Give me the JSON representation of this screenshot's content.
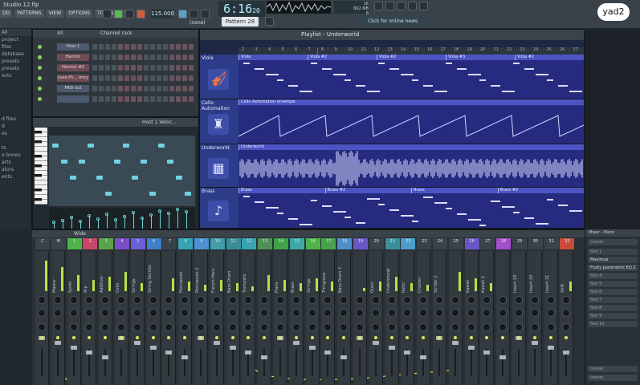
{
  "window": {
    "title": "Studio 12.flp",
    "menu": [
      "DD",
      "PATTERNS",
      "VIEW",
      "OPTIONS",
      "TOOLS",
      "?"
    ]
  },
  "transport": {
    "time": "6:16",
    "time_sub": "20",
    "tempo": "115.000",
    "pattern": "Pattern 28",
    "snap": "(none)",
    "cpu_line1": "16",
    "cpu_line2": "662 MB",
    "cpu_line3": "8",
    "online_news": "Click for online news"
  },
  "badge": {
    "text": "yad2"
  },
  "browser": {
    "items": [
      "All",
      "project",
      "files",
      "database",
      "presets",
      "presets",
      "ects",
      "",
      "",
      "",
      "",
      "",
      "d files",
      "d",
      "es",
      "",
      "ts",
      "e bones",
      "arts",
      "ators",
      "ents"
    ]
  },
  "channel_rack": {
    "title": "Channel rack",
    "filter": "All",
    "channels": [
      {
        "name": "Host 1",
        "style": "blue"
      },
      {
        "name": "Harmor",
        "style": "red"
      },
      {
        "name": "Harmor #2",
        "style": "red"
      },
      {
        "name": "Love Ph... rmcy",
        "style": "red"
      },
      {
        "name": "MIDI out",
        "style": "blue"
      },
      {
        "name": "",
        "style": "blue"
      }
    ]
  },
  "piano_roll": {
    "title": "Host 1 Veloc..."
  },
  "playlist": {
    "title": "Playlist - Underworld",
    "ruler": [
      "2",
      "3",
      "4",
      "5",
      "6",
      "7",
      "8",
      "9",
      "10",
      "11",
      "12",
      "13",
      "14",
      "15",
      "16",
      "17",
      "18",
      "19",
      "20",
      "21",
      "22",
      "23",
      "24",
      "25",
      "26",
      "27"
    ],
    "tracks": [
      {
        "name": "Viola",
        "icon": "🎻",
        "clips": [
          "Viola",
          "Viola #2",
          "Viola #2",
          "Viola #3",
          "Viola #2"
        ]
      },
      {
        "name": "Cello Automation",
        "icon": "♜",
        "clips": [
          "Cello Automation envelope"
        ]
      },
      {
        "name": "Underworld",
        "icon": "▦",
        "clips": [
          "Underworld"
        ]
      },
      {
        "name": "Brass",
        "icon": "♪",
        "clips": [
          "Brass",
          "Brass #2",
          "Brass",
          "Brass #2"
        ]
      }
    ]
  },
  "mixer": {
    "title": "Wide",
    "inserts": [
      {
        "num": "C",
        "name": "",
        "color": "#3a4349"
      },
      {
        "num": "M",
        "name": "Master",
        "color": "#3a4349"
      },
      {
        "num": "1",
        "name": "Synth",
        "color": "#4db34a"
      },
      {
        "num": "2",
        "name": "Arp",
        "color": "#c9466b"
      },
      {
        "num": "3",
        "name": "Additive",
        "color": "#5aa24a"
      },
      {
        "num": "4",
        "name": "Cello",
        "color": "#7a4fc9"
      },
      {
        "num": "5",
        "name": "Strings",
        "color": "#6a5fd6"
      },
      {
        "num": "6",
        "name": "String Section",
        "color": "#3d7fc9"
      },
      {
        "num": "7",
        "name": "",
        "color": "#3a4349"
      },
      {
        "num": "8",
        "name": "Percussion",
        "color": "#37a3b3"
      },
      {
        "num": "9",
        "name": "Percussion 2",
        "color": "#4e8fd6"
      },
      {
        "num": "10",
        "name": "French Horn",
        "color": "#3f9ea8"
      },
      {
        "num": "11",
        "name": "Bass Drum",
        "color": "#3c8d9a"
      },
      {
        "num": "12",
        "name": "Trumpets",
        "color": "#37a3b3"
      },
      {
        "num": "13",
        "name": "",
        "color": "#4d8f56"
      },
      {
        "num": "14",
        "name": "Piano",
        "color": "#3fa34a"
      },
      {
        "num": "15",
        "name": "Brass",
        "color": "#3fa6a8"
      },
      {
        "num": "16",
        "name": "Strings",
        "color": "#4db34a"
      },
      {
        "num": "17",
        "name": "Thingness",
        "color": "#46a34a"
      },
      {
        "num": "18",
        "name": "Bass Drum 2",
        "color": "#4d8fc9"
      },
      {
        "num": "19",
        "name": "",
        "color": "#6a56c9"
      },
      {
        "num": "20",
        "name": "Quiet",
        "color": "#3a4349"
      },
      {
        "num": "21",
        "name": "Undersound",
        "color": "#3c8d9a"
      },
      {
        "num": "22",
        "name": "Rotor",
        "color": "#4a9ec9"
      },
      {
        "num": "23",
        "name": "Crusher",
        "color": "#3a4349"
      },
      {
        "num": "24",
        "name": "Strider 2",
        "color": "#3a4349"
      },
      {
        "num": "25",
        "name": "",
        "color": "#3a4349"
      },
      {
        "num": "26",
        "name": "Kawaii",
        "color": "#6a56c9"
      },
      {
        "num": "27",
        "name": "Kawaii 2",
        "color": "#3a4349"
      },
      {
        "num": "28",
        "name": "",
        "color": "#a24fc9"
      },
      {
        "num": "29",
        "name": "Insert 29",
        "color": "#3a4349"
      },
      {
        "num": "30",
        "name": "Insert 30",
        "color": "#3a4349"
      },
      {
        "num": "31",
        "name": "Insert 31",
        "color": "#3a4349"
      },
      {
        "num": "32",
        "name": "Shift",
        "color": "#c94c39"
      }
    ]
  },
  "mixer_side": {
    "title": "Mixer - Piano",
    "preset": "(none)",
    "slots": [
      "Slot 1",
      "Maximus",
      "Fruity parametric EQ 2",
      "Slot 4",
      "Slot 5",
      "Slot 6",
      "Slot 7",
      "Slot 8",
      "Slot 9",
      "Slot 10"
    ],
    "bottom": [
      "(none)",
      "(none)"
    ]
  }
}
